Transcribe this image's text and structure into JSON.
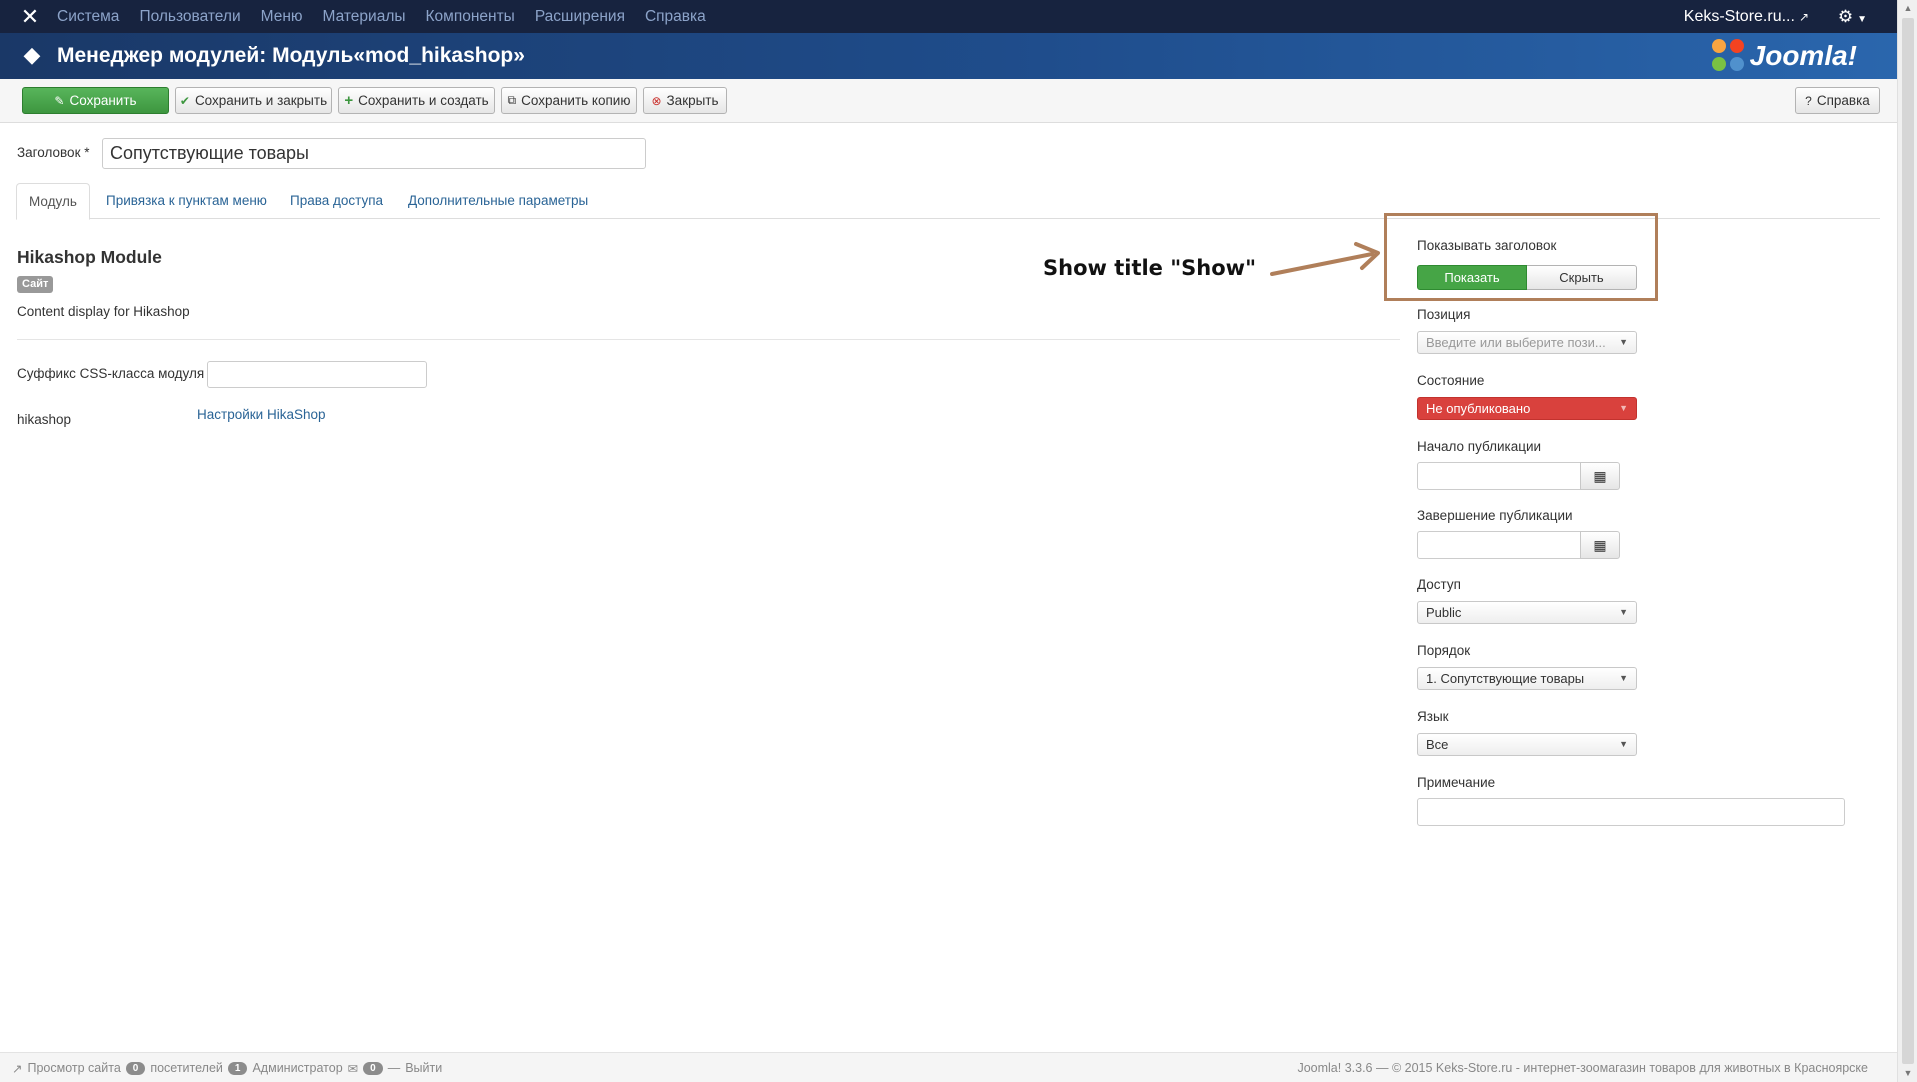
{
  "nav": {
    "menu": [
      "Система",
      "Пользователи",
      "Меню",
      "Материалы",
      "Компоненты",
      "Расширения",
      "Справка"
    ],
    "site_link": "Keks-Store.ru...",
    "icons": {
      "brand": "joomla-icon",
      "external": "external-link-icon",
      "settings": "gear-icon"
    }
  },
  "header": {
    "title": "Менеджер модулей: Модуль«mod_hikashop»",
    "logo_text": "Joomla!",
    "colors": {
      "bar": "#1f4d8c",
      "navbar": "#17233f"
    }
  },
  "toolbar": {
    "save": "Сохранить",
    "save_close": "Сохранить и закрыть",
    "save_new": "Сохранить и создать",
    "save_copy": "Сохранить копию",
    "close": "Закрыть",
    "help": "Справка"
  },
  "form": {
    "title_label": "Заголовок *",
    "title_value": "Сопутствующие товары"
  },
  "tabs": [
    {
      "label": "Модуль",
      "active": true
    },
    {
      "label": "Привязка к пунктам меню",
      "active": false
    },
    {
      "label": "Права доступа",
      "active": false
    },
    {
      "label": "Дополнительные параметры",
      "active": false
    }
  ],
  "module": {
    "name": "Hikashop Module",
    "badge": "Сайт",
    "description": "Content display for Hikashop",
    "css_suffix_label": "Суффикс CSS-класса модуля",
    "css_suffix_value": "",
    "hikashop_label": "hikashop",
    "hikashop_link": "Настройки HikaShop"
  },
  "sidebar": {
    "show_title_label": "Показывать заголовок",
    "show_option": "Показать",
    "hide_option": "Скрыть",
    "position_label": "Позиция",
    "position_placeholder": "Введите или выберите пози...",
    "state_label": "Состояние",
    "state_value": "Не опубликовано",
    "publish_up_label": "Начало публикации",
    "publish_down_label": "Завершение публикации",
    "access_label": "Доступ",
    "access_value": "Public",
    "ordering_label": "Порядок",
    "ordering_value": "1. Сопутствующие товары",
    "language_label": "Язык",
    "language_value": "Все",
    "note_label": "Примечание",
    "note_value": ""
  },
  "annotation": {
    "text": "Show title \"Show\"",
    "color": "#b07f5a"
  },
  "footer": {
    "view_site": "Просмотр сайта",
    "visitors_count": "0",
    "visitors_label": "посетителей",
    "admins_count": "1",
    "admins_label": "Администратор",
    "messages_count": "0",
    "logout": "Выйти",
    "copyright": "Joomla! 3.3.6 — © 2015 Keks-Store.ru - интернет-зоомагазин товаров для животных в Красноярске"
  }
}
